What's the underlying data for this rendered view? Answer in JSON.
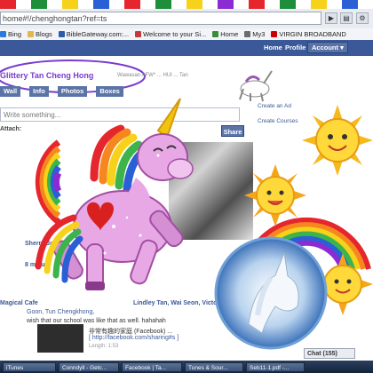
{
  "stripe_colors": [
    "#e5262d",
    "#fff",
    "#1f8e3a",
    "#fff",
    "#f6d21b",
    "#fff",
    "#2a5fd6",
    "#fff",
    "#e5262d",
    "#fff",
    "#1f8e3a",
    "#fff",
    "#f6d21b",
    "#fff",
    "#8b2bd1",
    "#fff",
    "#e5262d",
    "#fff",
    "#1f8e3a",
    "#fff",
    "#f6d21b",
    "#fff",
    "#2a5fd6",
    "#fff"
  ],
  "browser": {
    "url": "home#!/chenghongtan?ref=ts",
    "bookmarks": [
      {
        "label": "Bing",
        "icon": "bing-icon",
        "color": "#2a7adb"
      },
      {
        "label": "Blogs",
        "icon": "folder-icon",
        "color": "#e2b74c"
      },
      {
        "label": "BibleGateway.com:...",
        "icon": "bible-icon",
        "color": "#2b5bab"
      },
      {
        "label": "Welcome to your Si...",
        "icon": "page-icon",
        "color": "#c23b3b"
      },
      {
        "label": "Home",
        "icon": "page-icon",
        "color": "#3a8b3a"
      },
      {
        "label": "My3",
        "icon": "page-icon",
        "color": "#6d6d6d"
      },
      {
        "label": "VIRGIN BROADBAND",
        "icon": "page-icon",
        "color": "#cc0000"
      }
    ]
  },
  "facebook": {
    "nav_home": "Home",
    "nav_profile": "Profile",
    "nav_account": "Account ▾"
  },
  "profile": {
    "name": "Glittery Tan Cheng Hong",
    "subtitle": "Wawasan AFW* ... HUI ... Tan",
    "tabs": [
      "Wall",
      "Info",
      "Photos",
      "Boxes"
    ],
    "composer_placeholder": "Write something...",
    "attach_label": "Attach:",
    "share_label": "Share"
  },
  "sidebar": {
    "links": [
      "Create an Ad",
      "Create Courses"
    ]
  },
  "feed": {
    "name": "Sherry Jared",
    "time": "8 minute",
    "line1": "Magical Cafe",
    "lindley": "Lindley Tan, Wai Seon, Victor Y...",
    "line2": "Goon, Tun Chengkhong,",
    "line3": "wish that our school was like that as well. hahahah",
    "line4": "非常有趣的家庭 (Facebook) ...",
    "line5": "[ http://facebook.com/sharing#s ]",
    "line6": "Length: 1:53"
  },
  "chat": {
    "label": "Chat (155)"
  },
  "taskbar": [
    "iTunes",
    "Conndyll - Getc...",
    "Facebook | Ta...",
    "Tunes & Sour...",
    "Seb11-1.pdf -..."
  ]
}
